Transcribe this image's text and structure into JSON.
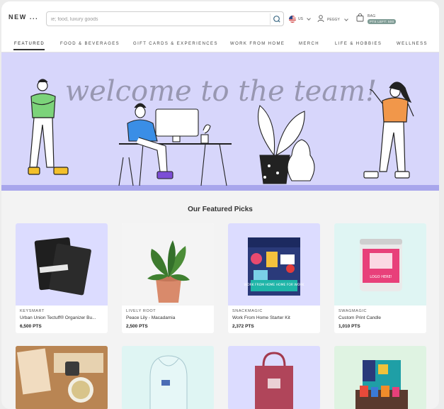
{
  "header": {
    "brand": "NEW ...",
    "search_placeholder": "ie; food, luxury goods",
    "locale": "US",
    "user": "PEGGY",
    "bag_label": "BAG",
    "bag_badge": "PTS LEFT: 500"
  },
  "nav": {
    "items": [
      {
        "label": "FEATURED",
        "active": true
      },
      {
        "label": "FOOD & BEVERAGES",
        "active": false
      },
      {
        "label": "GIFT CARDS & EXPERIENCES",
        "active": false
      },
      {
        "label": "WORK FROM HOME",
        "active": false
      },
      {
        "label": "MERCH",
        "active": false
      },
      {
        "label": "LIFE & HOBBIES",
        "active": false
      },
      {
        "label": "WELLNESS",
        "active": false
      }
    ]
  },
  "banner": {
    "headline": "welcome to the team!",
    "background": "#d7d6fb"
  },
  "featured": {
    "title": "Our Featured Picks",
    "products": [
      {
        "vendor": "KEYSMART",
        "name": "Urban Union Tectuff® Organizer Bu...",
        "points": "6,500 PTS"
      },
      {
        "vendor": "LIVELY ROOT",
        "name": "Peace Lily - Macadamia",
        "points": "2,500 PTS"
      },
      {
        "vendor": "SNACKMAGIC",
        "name": "Work From Home Starter Kit",
        "points": "2,372 PTS"
      },
      {
        "vendor": "SWAGMAGIC",
        "name": "Custom Print Candle",
        "points": "1,010 PTS"
      }
    ],
    "candle_label": "LOGO HERE!",
    "box_label": "WORK FROM HOME HOME FOR WORK"
  },
  "colors": {
    "accent": "#7f9c95",
    "card_lavender": "#dcdcff",
    "card_white": "#ffffff",
    "card_mint": "#dff5f3"
  }
}
